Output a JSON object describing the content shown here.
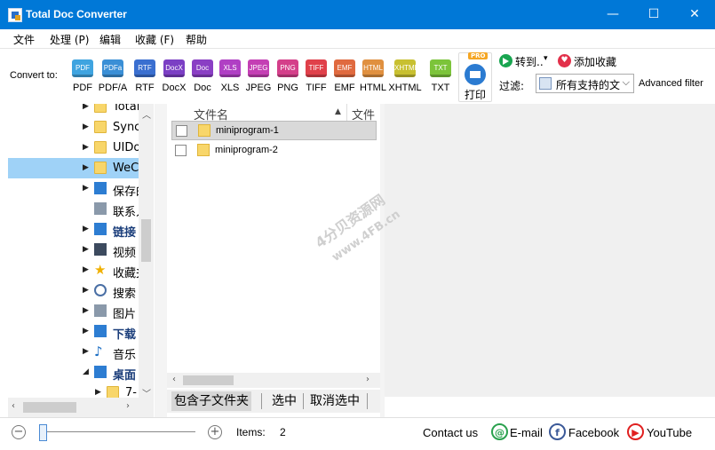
{
  "window": {
    "title": "Total Doc Converter",
    "minimize": "—",
    "maximize": "☐",
    "close": "✕"
  },
  "menu": [
    "文件",
    "处理 (P)",
    "编辑",
    "收藏 (F)",
    "帮助"
  ],
  "toolbar": {
    "convert_label": "Convert to:",
    "formats": [
      {
        "badge": "PDF",
        "label": "PDF",
        "color": "#3fa4e0"
      },
      {
        "badge": "PDFa",
        "label": "PDF/A",
        "color": "#3a8fd6"
      },
      {
        "badge": "RTF",
        "label": "RTF",
        "color": "#3a6fd0"
      },
      {
        "badge": "DocX",
        "label": "DocX",
        "color": "#7b3fc4"
      },
      {
        "badge": "Doc",
        "label": "Doc",
        "color": "#8a3fc4"
      },
      {
        "badge": "XLS",
        "label": "XLS",
        "color": "#b03fc4"
      },
      {
        "badge": "JPEG",
        "label": "JPEG",
        "color": "#c43fb4"
      },
      {
        "badge": "PNG",
        "label": "PNG",
        "color": "#d43f8a"
      },
      {
        "badge": "TIFF",
        "label": "TIFF",
        "color": "#e0404a"
      },
      {
        "badge": "EMF",
        "label": "EMF",
        "color": "#e06a3f"
      },
      {
        "badge": "HTML",
        "label": "HTML",
        "color": "#e0903f"
      },
      {
        "badge": "XHTML",
        "label": "XHTML",
        "color": "#c8c030"
      },
      {
        "badge": "TXT",
        "label": "TXT",
        "color": "#7cc43a"
      }
    ],
    "pro_tag": "PRO",
    "print_label": "打印",
    "goto_label": "转到..",
    "goto_arrow": "▾",
    "favorite_label": "添加收藏",
    "favorite_icon_glyph": "♥",
    "filter_label": "过滤:",
    "filter_value": "所有支持的文件",
    "advanced_filter": "Advanced filter"
  },
  "tree": {
    "items": [
      {
        "label": "Total",
        "icon": "folder-icon",
        "cls": "folder",
        "expandable": true,
        "selected": false
      },
      {
        "label": "Sync",
        "icon": "folder-icon",
        "cls": "folder",
        "expandable": true,
        "selected": false
      },
      {
        "label": "UIDownloads",
        "icon": "folder-icon",
        "cls": "folder",
        "expandable": true,
        "selected": false
      },
      {
        "label": "WeChat",
        "icon": "folder-icon",
        "cls": "folder",
        "expandable": true,
        "selected": true
      },
      {
        "label": "保存的游戏",
        "icon": "saved-games-icon",
        "cls": "blue",
        "expandable": true,
        "selected": false
      },
      {
        "label": "联系人",
        "icon": "contacts-icon",
        "cls": "gray",
        "expandable": false,
        "selected": false
      },
      {
        "label": "链接",
        "icon": "links-icon",
        "cls": "blue",
        "expandable": true,
        "selected": false
      },
      {
        "label": "视频",
        "icon": "videos-icon",
        "cls": "grid",
        "expandable": true,
        "selected": false
      },
      {
        "label": "收藏夹",
        "icon": "favorites-icon",
        "cls": "star",
        "expandable": true,
        "selected": false
      },
      {
        "label": "搜索",
        "icon": "search-icon",
        "cls": "mag",
        "expandable": true,
        "selected": false
      },
      {
        "label": "图片",
        "icon": "pictures-icon",
        "cls": "gray",
        "expandable": true,
        "selected": false
      },
      {
        "label": "下载",
        "icon": "downloads-icon",
        "cls": "blue",
        "expandable": true,
        "selected": false
      },
      {
        "label": "音乐",
        "icon": "music-icon",
        "cls": "music",
        "expandable": true,
        "selected": false
      },
      {
        "label": "桌面",
        "icon": "desktop-icon",
        "cls": "blue",
        "expandable": true,
        "expanded": true,
        "selected": false
      },
      {
        "label": "7-",
        "icon": "folder-icon",
        "cls": "folder",
        "expandable": true,
        "selected": false,
        "indent": true
      }
    ]
  },
  "filelist": {
    "column_name": "文件名",
    "column_type": "文件",
    "sort_indicator": "▲",
    "rows": [
      {
        "name": "miniprogram-1",
        "selected": true
      },
      {
        "name": "miniprogram-2",
        "selected": false
      }
    ],
    "buttons": [
      "包含子文件夹",
      "选中",
      "取消选中"
    ]
  },
  "statusbar": {
    "zoom_out": "−",
    "zoom_in": "+",
    "zoom_level": 0,
    "items_label": "Items:",
    "items_count": "2",
    "contact": "Contact us",
    "links": [
      {
        "label": "E-mail",
        "icon": "email-icon",
        "glyph": "@",
        "color": "#2aa14e"
      },
      {
        "label": "Facebook",
        "icon": "facebook-icon",
        "glyph": "f",
        "color": "#3b5998"
      },
      {
        "label": "YouTube",
        "icon": "youtube-icon",
        "glyph": "▶",
        "color": "#e02020"
      }
    ]
  },
  "watermark": {
    "line1": "4分贝资源网",
    "line2": "www.4FB.cn"
  }
}
